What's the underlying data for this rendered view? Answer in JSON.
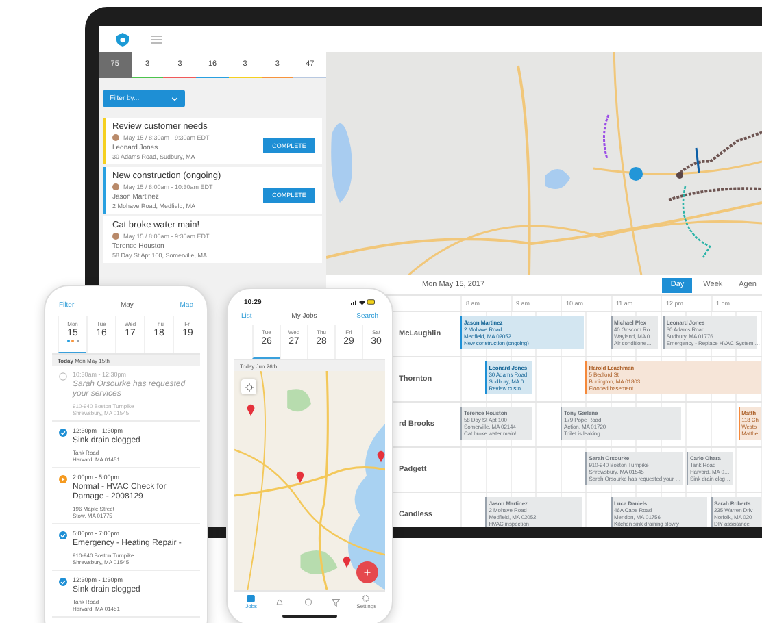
{
  "laptop": {
    "status_tabs": [
      {
        "count": "75",
        "selected": true,
        "color": "#6d6d6d"
      },
      {
        "count": "3",
        "selected": false,
        "color": "#4cc34c"
      },
      {
        "count": "3",
        "selected": false,
        "color": "#f05a5a"
      },
      {
        "count": "16",
        "selected": false,
        "color": "#29a0e0"
      },
      {
        "count": "3",
        "selected": false,
        "color": "#f5d020"
      },
      {
        "count": "3",
        "selected": false,
        "color": "#f7943c"
      },
      {
        "count": "47",
        "selected": false,
        "color": "#b8c8e0"
      }
    ],
    "filter": {
      "label": "Filter by..."
    },
    "job_cards": [
      {
        "title": "Review customer needs",
        "when": "May 15 / 8:30am - 9:30am EDT",
        "customer": "Leonard Jones",
        "address": "30 Adams Road, Sudbury, MA",
        "action": "COMPLETE",
        "color": "#f5d020"
      },
      {
        "title": "New construction (ongoing)",
        "when": "May 15 / 8:00am - 10:30am EDT",
        "customer": "Jason Martinez",
        "address": "2 Mohave Road, Medfield, MA",
        "action": "COMPLETE",
        "color": "#29a0e0"
      },
      {
        "title": "Cat broke water main!",
        "when": "May 15 / 8:00am - 9:30am EDT",
        "customer": "Terence Houston",
        "address": "58 Day St Apt 100, Somerville, MA"
      }
    ],
    "schedule": {
      "date": "Mon May 15, 2017",
      "views": [
        {
          "label": "Day",
          "selected": true
        },
        {
          "label": "Week",
          "selected": false
        },
        {
          "label": "Agen",
          "selected": false
        }
      ],
      "hours": [
        "8 am",
        "9 am",
        "10 am",
        "11 am",
        "12 pm",
        "1 pm"
      ],
      "rows": [
        {
          "name": "McLaughlin",
          "events": [
            {
              "color": "#1e90d6",
              "lines": [
                "Jason Martinez",
                "2 Mohave Road",
                "Medfield, MA 02052",
                "New construction (ongoing)"
              ]
            },
            {
              "color": "#9aa3ad",
              "lines": [
                "Michael Plex",
                "40 Griscom Ro…",
                "Wayland, MA 0…",
                "Air conditione…"
              ]
            },
            {
              "color": "#9aa3ad",
              "lines": [
                "Leonard Jones",
                "30 Adams Road",
                "Sudbury, MA 01776",
                "Emergency - Replace HVAC System …"
              ]
            }
          ]
        },
        {
          "name": "Thornton",
          "events": [
            {
              "color": "#1e90d6",
              "lines": [
                "Leonard Jones",
                "30 Adams Road",
                "Sudbury, MA 0…",
                "Review custo…"
              ]
            },
            {
              "color": "#f5893b",
              "lines": [
                "Harold Leachman",
                "5 Bedford St",
                "Burlington, MA 01803",
                "Flooded basement"
              ]
            }
          ]
        },
        {
          "name": "rd Brooks",
          "events": [
            {
              "color": "#9aa3ad",
              "lines": [
                "Terence Houston",
                "58 Day St Apt 100",
                "Somerville, MA 02144",
                "Cat broke water main!"
              ]
            },
            {
              "color": "#9aa3ad",
              "lines": [
                "Tony Garlene",
                "179 Pope Road",
                "Action, MA 01720",
                "Toilet is leaking"
              ]
            },
            {
              "color": "#f5893b",
              "lines": [
                "Matth",
                "118 Ch",
                "Westo",
                "Matthe"
              ]
            }
          ]
        },
        {
          "name": "Padgett",
          "events": [
            {
              "color": "#9aa3ad",
              "lines": [
                "Sarah Orsourke",
                "910-940 Boston Turnpike",
                "Shrewsbury, MA 01545",
                "Sarah Orsourke has requested your …"
              ]
            },
            {
              "color": "#9aa3ad",
              "lines": [
                "Carlo Ohara",
                "Tank Road",
                "Harvard, MA 0…",
                "Sink drain clog…"
              ]
            }
          ]
        },
        {
          "name": "Candless",
          "events": [
            {
              "color": "#9aa3ad",
              "lines": [
                "Jason Martinez",
                "2 Mohave Road",
                "Medfield, MA 02052",
                "HVAC inspection"
              ]
            },
            {
              "color": "#9aa3ad",
              "lines": [
                "Luca Daniels",
                "46A Cape Road",
                "Mendon, MA 01756",
                "Kitchen sink draining slowly"
              ]
            },
            {
              "color": "#9aa3ad",
              "lines": [
                "Sarah Roberts",
                "235 Warren Driv",
                "Norfolk, MA 020",
                "DIY assistance"
              ]
            }
          ]
        }
      ]
    }
  },
  "phone_list": {
    "left_action": "Filter",
    "title": "May",
    "right_action": "Map",
    "days": [
      {
        "weekday": "Mon",
        "day": "15",
        "selected": true,
        "dots": [
          {
            "color": "#29a0e0"
          },
          {
            "color": "#f7943c"
          },
          {
            "color": "#9aa3ad"
          }
        ]
      },
      {
        "weekday": "Tue",
        "day": "16",
        "selected": false
      },
      {
        "weekday": "Wed",
        "day": "17",
        "selected": false
      },
      {
        "weekday": "Thu",
        "day": "18",
        "selected": false
      },
      {
        "weekday": "Fri",
        "day": "19",
        "selected": false
      }
    ],
    "today": "**Today** Mon May 15th",
    "jobs": [
      {
        "kind": "pending",
        "time": "10:30am - 12:30pm",
        "title": "Sarah Orsourke has requested your services",
        "address": "910-940 Boston Turnpike",
        "city": "Shrewsbury, MA 01545"
      },
      {
        "kind": "done",
        "time": "12:30pm - 1:30pm",
        "title": "Sink drain clogged",
        "address": "Tank Road",
        "city": "Harvard, MA 01451"
      },
      {
        "kind": "in_progress",
        "time": "2:00pm - 5:00pm",
        "title": "Normal - HVAC Check for Damage - 2008129",
        "address": "196 Maple Street",
        "city": "Stow, MA 01775"
      },
      {
        "kind": "done",
        "time": "5:00pm - 7:00pm",
        "title": "Emergency - Heating Repair -",
        "address": "910-940 Boston Turnpike",
        "city": "Shrewsbury, MA 01545"
      },
      {
        "kind": "done",
        "time": "12:30pm - 1:30pm",
        "title": "Sink drain clogged",
        "address": "Tank Road",
        "city": "Harvard, MA 01451"
      }
    ]
  },
  "phone_map": {
    "clock": "10:29",
    "left_action": "List",
    "title": "My Jobs",
    "right_action": "Search",
    "days": [
      {
        "weekday": "Tue",
        "day": "26",
        "selected": true
      },
      {
        "weekday": "Wed",
        "day": "27",
        "selected": false
      },
      {
        "weekday": "Thu",
        "day": "28",
        "selected": false
      },
      {
        "weekday": "Fri",
        "day": "29",
        "selected": false
      },
      {
        "weekday": "Sat",
        "day": "30",
        "selected": false
      }
    ],
    "today": "Today Jun 26th",
    "tab_bar": [
      {
        "label": "Jobs",
        "selected": true
      },
      {
        "selected": false
      },
      {
        "selected": false
      },
      {
        "selected": false
      },
      {
        "label": "Settings",
        "selected": false
      }
    ]
  }
}
